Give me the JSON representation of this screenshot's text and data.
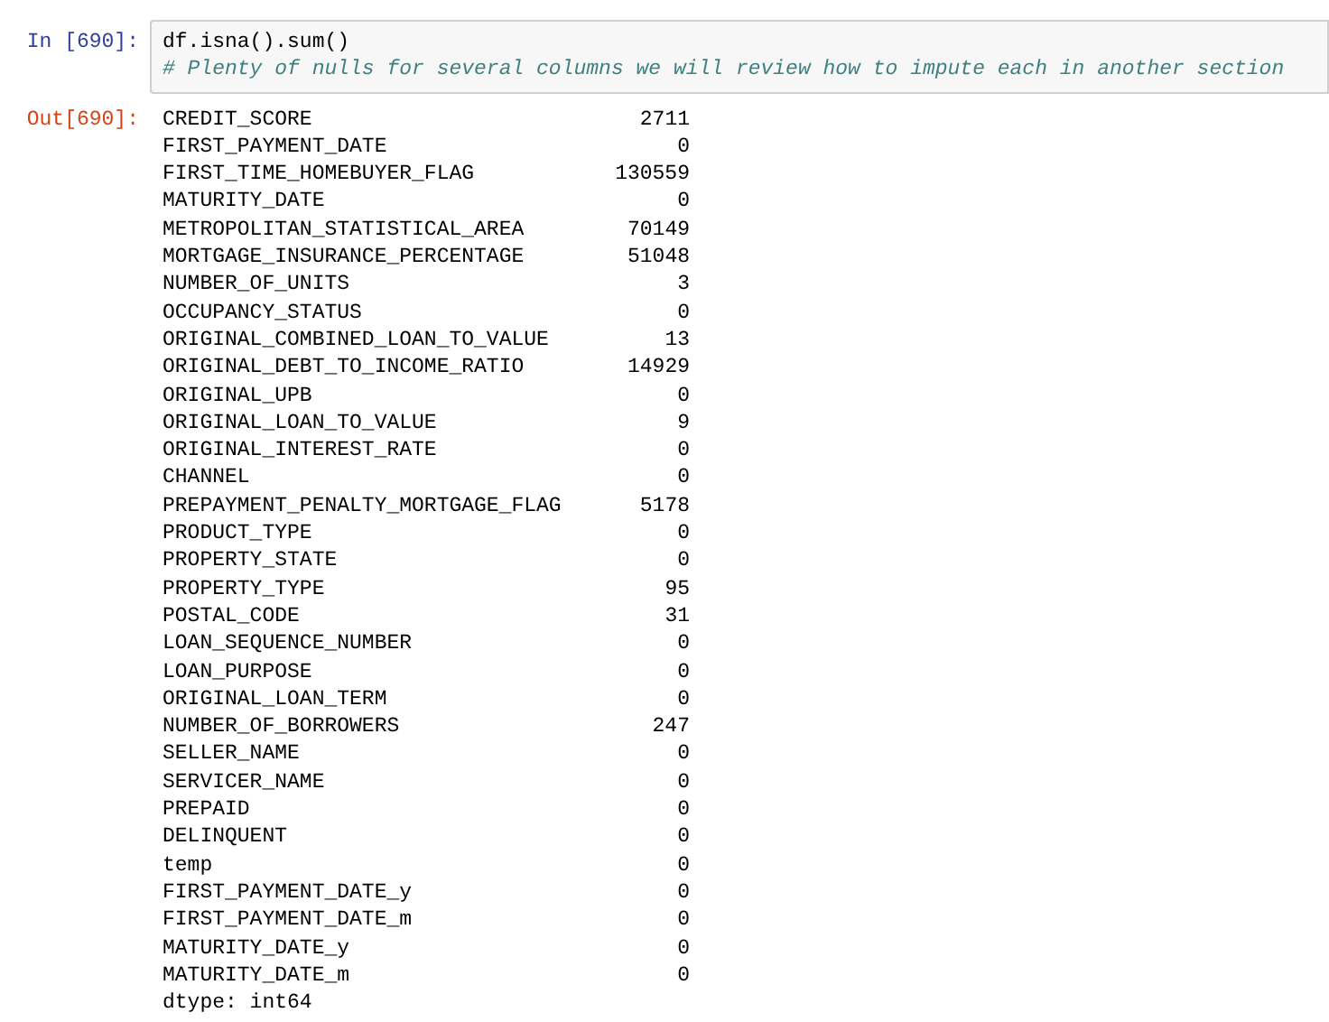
{
  "input_cell": {
    "prompt": "In [690]:",
    "code": "df.isna().sum()",
    "comment": "# Plenty of nulls for several columns we will review how to impute each in another section"
  },
  "output_cell": {
    "prompt": "Out[690]:",
    "rows": [
      {
        "name": "CREDIT_SCORE",
        "value": "2711"
      },
      {
        "name": "FIRST_PAYMENT_DATE",
        "value": "0"
      },
      {
        "name": "FIRST_TIME_HOMEBUYER_FLAG",
        "value": "130559"
      },
      {
        "name": "MATURITY_DATE",
        "value": "0"
      },
      {
        "name": "METROPOLITAN_STATISTICAL_AREA",
        "value": "70149"
      },
      {
        "name": "MORTGAGE_INSURANCE_PERCENTAGE",
        "value": "51048"
      },
      {
        "name": "NUMBER_OF_UNITS",
        "value": "3"
      },
      {
        "name": "OCCUPANCY_STATUS",
        "value": "0"
      },
      {
        "name": "ORIGINAL_COMBINED_LOAN_TO_VALUE",
        "value": "13"
      },
      {
        "name": "ORIGINAL_DEBT_TO_INCOME_RATIO",
        "value": "14929"
      },
      {
        "name": "ORIGINAL_UPB",
        "value": "0"
      },
      {
        "name": "ORIGINAL_LOAN_TO_VALUE",
        "value": "9"
      },
      {
        "name": "ORIGINAL_INTEREST_RATE",
        "value": "0"
      },
      {
        "name": "CHANNEL",
        "value": "0"
      },
      {
        "name": "PREPAYMENT_PENALTY_MORTGAGE_FLAG",
        "value": "5178"
      },
      {
        "name": "PRODUCT_TYPE",
        "value": "0"
      },
      {
        "name": "PROPERTY_STATE",
        "value": "0"
      },
      {
        "name": "PROPERTY_TYPE",
        "value": "95"
      },
      {
        "name": "POSTAL_CODE",
        "value": "31"
      },
      {
        "name": "LOAN_SEQUENCE_NUMBER",
        "value": "0"
      },
      {
        "name": "LOAN_PURPOSE",
        "value": "0"
      },
      {
        "name": "ORIGINAL_LOAN_TERM",
        "value": "0"
      },
      {
        "name": "NUMBER_OF_BORROWERS",
        "value": "247"
      },
      {
        "name": "SELLER_NAME",
        "value": "0"
      },
      {
        "name": "SERVICER_NAME",
        "value": "0"
      },
      {
        "name": "PREPAID",
        "value": "0"
      },
      {
        "name": "DELINQUENT",
        "value": "0"
      },
      {
        "name": "temp",
        "value": "0"
      },
      {
        "name": "FIRST_PAYMENT_DATE_y",
        "value": "0"
      },
      {
        "name": "FIRST_PAYMENT_DATE_m",
        "value": "0"
      },
      {
        "name": "MATURITY_DATE_y",
        "value": "0"
      },
      {
        "name": "MATURITY_DATE_m",
        "value": "0"
      }
    ],
    "dtype": "dtype: int64"
  }
}
